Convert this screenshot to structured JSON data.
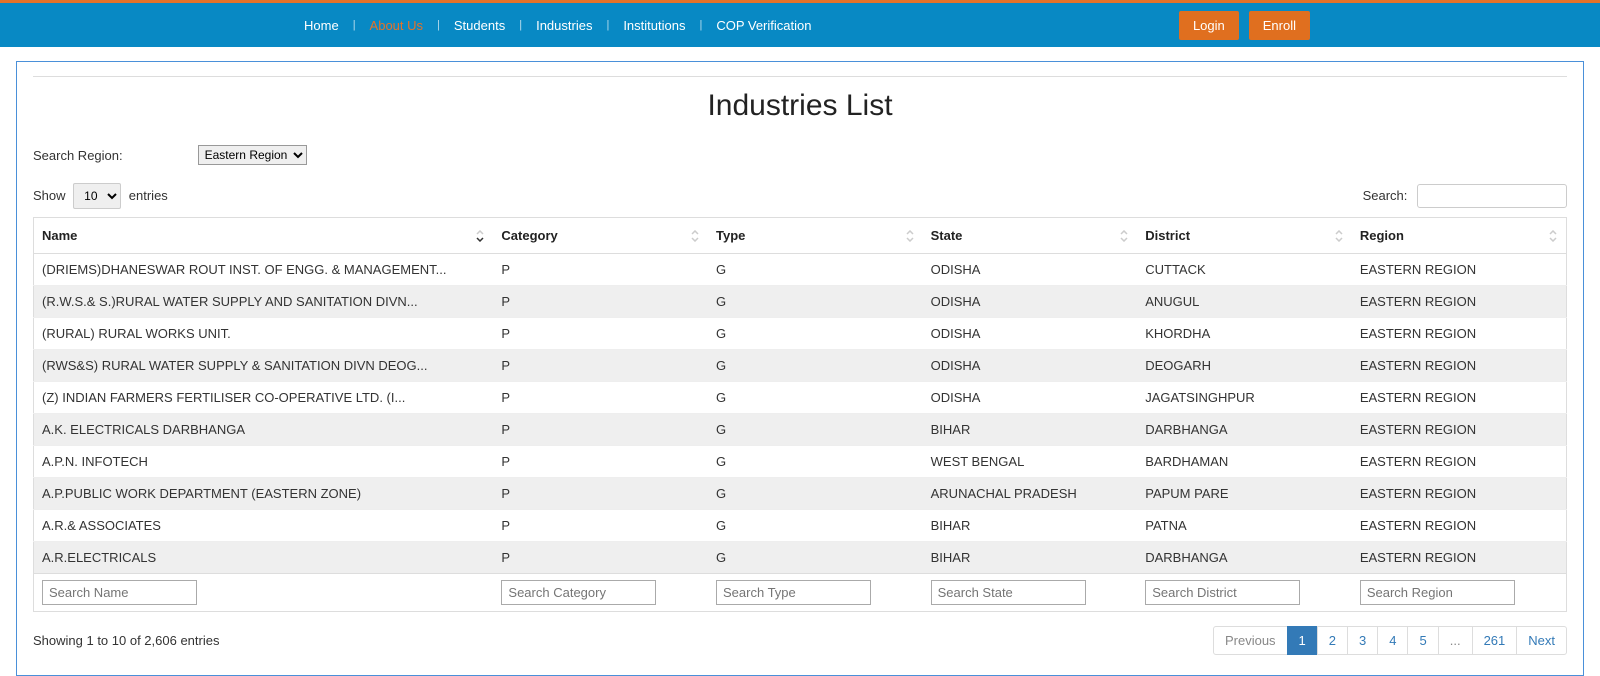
{
  "nav": {
    "items": [
      {
        "label": "Home",
        "active": false
      },
      {
        "label": "About Us",
        "active": true
      },
      {
        "label": "Students",
        "active": false
      },
      {
        "label": "Industries",
        "active": false
      },
      {
        "label": "Institutions",
        "active": false
      },
      {
        "label": "COP Verification",
        "active": false
      }
    ],
    "login": "Login",
    "enroll": "Enroll"
  },
  "page": {
    "title": "Industries List",
    "search_region_label": "Search Region:",
    "region_selected": "Eastern Region",
    "show_label": "Show",
    "entries_label": "entries",
    "show_value": "10",
    "search_label": "Search:",
    "search_value": "",
    "info_text": "Showing 1 to 10 of 2,606 entries"
  },
  "table": {
    "headers": [
      "Name",
      "Category",
      "Type",
      "State",
      "District",
      "Region"
    ],
    "rows": [
      {
        "name": "(DRIEMS)DHANESWAR ROUT INST. OF ENGG. & MANAGEMENT...",
        "category": "P",
        "type": "G",
        "state": "ODISHA",
        "district": "CUTTACK",
        "region": "EASTERN REGION"
      },
      {
        "name": "(R.W.S.& S.)RURAL WATER SUPPLY AND SANITATION DIVN...",
        "category": "P",
        "type": "G",
        "state": "ODISHA",
        "district": "ANUGUL",
        "region": "EASTERN REGION"
      },
      {
        "name": "(RURAL) RURAL WORKS UNIT.",
        "category": "P",
        "type": "G",
        "state": "ODISHA",
        "district": "KHORDHA",
        "region": "EASTERN REGION"
      },
      {
        "name": "(RWS&S) RURAL WATER SUPPLY & SANITATION DIVN DEOG...",
        "category": "P",
        "type": "G",
        "state": "ODISHA",
        "district": "DEOGARH",
        "region": "EASTERN REGION"
      },
      {
        "name": "(Z) INDIAN FARMERS FERTILISER CO-OPERATIVE LTD. (I...",
        "category": "P",
        "type": "G",
        "state": "ODISHA",
        "district": "JAGATSINGHPUR",
        "region": "EASTERN REGION"
      },
      {
        "name": "A.K. ELECTRICALS DARBHANGA",
        "category": "P",
        "type": "G",
        "state": "BIHAR",
        "district": "DARBHANGA",
        "region": "EASTERN REGION"
      },
      {
        "name": "A.P.N. INFOTECH",
        "category": "P",
        "type": "G",
        "state": "WEST BENGAL",
        "district": "BARDHAMAN",
        "region": "EASTERN REGION"
      },
      {
        "name": "A.P.PUBLIC WORK DEPARTMENT (EASTERN ZONE)",
        "category": "P",
        "type": "G",
        "state": "ARUNACHAL PRADESH",
        "district": "PAPUM PARE",
        "region": "EASTERN REGION"
      },
      {
        "name": "A.R.& ASSOCIATES",
        "category": "P",
        "type": "G",
        "state": "BIHAR",
        "district": "PATNA",
        "region": "EASTERN REGION"
      },
      {
        "name": "A.R.ELECTRICALS",
        "category": "P",
        "type": "G",
        "state": "BIHAR",
        "district": "DARBHANGA",
        "region": "EASTERN REGION"
      }
    ],
    "filters": {
      "name_ph": "Search Name",
      "category_ph": "Search Category",
      "type_ph": "Search Type",
      "state_ph": "Search State",
      "district_ph": "Search District",
      "region_ph": "Search Region"
    }
  },
  "pagination": {
    "previous": "Previous",
    "next": "Next",
    "pages": [
      "1",
      "2",
      "3",
      "4",
      "5"
    ],
    "ellipsis": "...",
    "last": "261",
    "active": "1"
  }
}
